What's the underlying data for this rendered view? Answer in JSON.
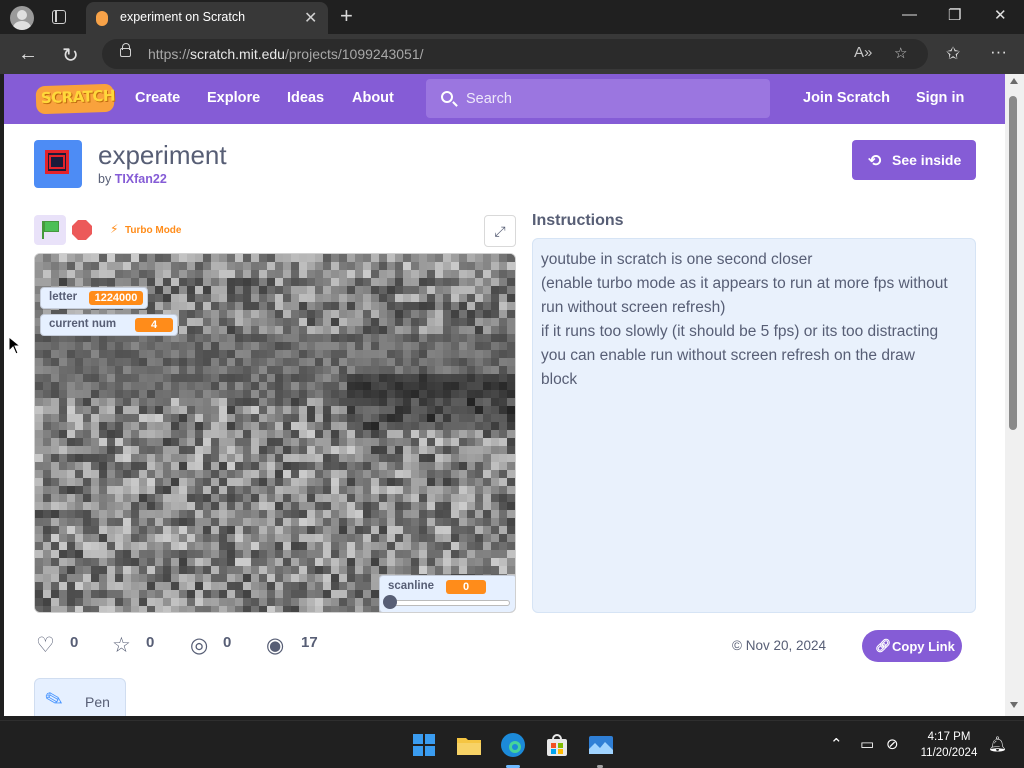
{
  "browser": {
    "tab_title": "experiment on Scratch",
    "url_scheme": "https://",
    "url_host": "scratch.mit.edu",
    "url_path": "/projects/1099243051/",
    "icons": [
      "profile-icon",
      "tab-actions-icon",
      "new-tab-icon",
      "minimize-icon",
      "maximize-icon",
      "close-icon",
      "back-icon",
      "refresh-icon",
      "lock-icon",
      "read-aloud-icon",
      "favorite-icon",
      "favorites-icon",
      "more-icon"
    ]
  },
  "scratch_nav": {
    "logo_text": "SCRATCH",
    "links": [
      "Create",
      "Explore",
      "Ideas",
      "About"
    ],
    "search_placeholder": "Search",
    "join": "Join Scratch",
    "signin": "Sign in",
    "color": "#855cd6"
  },
  "project": {
    "title": "experiment",
    "by_prefix": "by",
    "author": "TIXfan22",
    "see_inside": "See inside",
    "turbo_label": "Turbo Mode"
  },
  "stage": {
    "monitors": [
      {
        "label": "letter",
        "value": "1224000"
      },
      {
        "label": "current num",
        "value": "4"
      }
    ],
    "slider": {
      "label": "scanline",
      "value": "0"
    }
  },
  "instructions": {
    "heading": "Instructions",
    "lines": [
      "youtube in scratch is one second closer",
      "(enable turbo mode as it appears to run at more fps without",
      "run without screen refresh)",
      "if it runs too slowly (it should be 5 fps) or its too distracting",
      "you can enable run without screen refresh on the draw",
      "block"
    ],
    "background": "#e9f1fc"
  },
  "stats": {
    "loves": "0",
    "favorites": "0",
    "remixes": "0",
    "views": "17",
    "date": "Nov 20, 2024",
    "copy_link": "Copy Link"
  },
  "tags": {
    "pen": "Pen"
  },
  "taskbar": {
    "time": "4:17 PM",
    "date": "11/20/2024",
    "apps": [
      "start-icon",
      "file-explorer-icon",
      "edge-icon",
      "store-icon",
      "app-icon"
    ]
  }
}
